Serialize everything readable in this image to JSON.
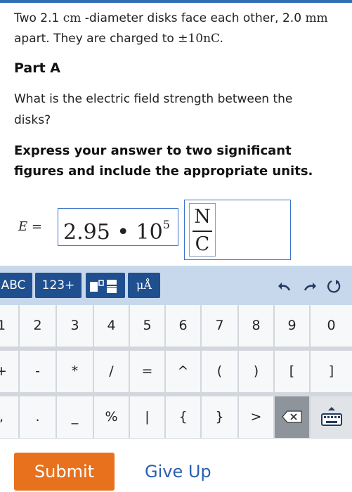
{
  "problem": {
    "text_before": "Two ",
    "diameter_value": "2.1",
    "diameter_unit": "cm",
    "text_mid": " -diameter disks face each other, 2.0 ",
    "gap_unit": "mm",
    "text_after": " apart. They are charged to ",
    "charge": "±10nC",
    "period": "."
  },
  "part": {
    "title": "Part A"
  },
  "question": "What is the electric field strength between the disks?",
  "instructions": "Express your answer to two significant figures and include the appropriate units.",
  "answer": {
    "label": "E =",
    "value": "2.95 • 10",
    "exponent": "5",
    "units_numerator": "N",
    "units_denominator": "C"
  },
  "keyboard": {
    "tabs": {
      "abc": "ABC",
      "num": "123+",
      "units": "μÅ"
    },
    "rows": [
      [
        "1",
        "2",
        "3",
        "4",
        "5",
        "6",
        "7",
        "8",
        "9",
        "0"
      ],
      [
        "+",
        "-",
        "*",
        "/",
        "=",
        "^",
        "(",
        ")",
        "[",
        "]"
      ],
      [
        ",",
        ".",
        "_",
        "%",
        "|",
        "{",
        "}",
        ">",
        "",
        ""
      ]
    ],
    "icons": [
      "undo-icon",
      "redo-icon",
      "reset-icon",
      "template-icon",
      "backspace-icon",
      "keyboard-icon"
    ]
  },
  "actions": {
    "submit": "Submit",
    "give_up": "Give Up"
  },
  "colors": {
    "accent": "#2f6db5",
    "submit": "#e8711e",
    "link": "#2a5fb0",
    "toolbar": "#c7d8ec"
  }
}
